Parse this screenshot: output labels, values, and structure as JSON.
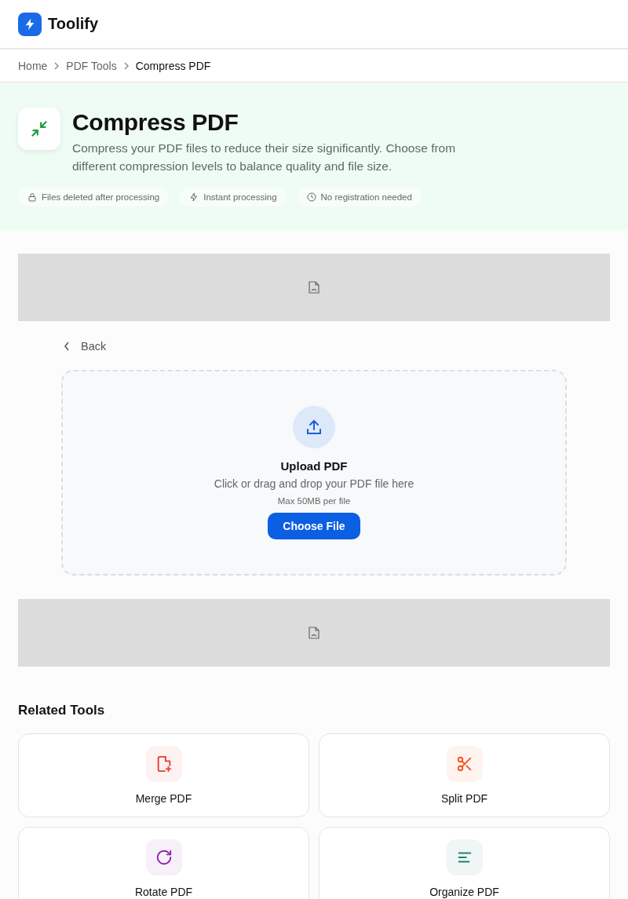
{
  "header": {
    "brand": "Toolify"
  },
  "breadcrumb": [
    {
      "label": "Home",
      "current": false
    },
    {
      "label": "PDF Tools",
      "current": false
    },
    {
      "label": "Compress PDF",
      "current": true
    }
  ],
  "hero": {
    "title": "Compress PDF",
    "description": "Compress your PDF files to reduce their size significantly. Choose from different compression levels to balance quality and file size.",
    "badges": [
      {
        "kind": "lock",
        "label": "Files deleted after processing"
      },
      {
        "kind": "bolt",
        "label": "Instant processing"
      },
      {
        "kind": "clock",
        "label": "No registration needed"
      }
    ]
  },
  "back": "Back",
  "upload": {
    "title": "Upload PDF",
    "hint": "Click or drag and drop your PDF file here",
    "limit": "Max 50MB per file",
    "button": "Choose File"
  },
  "related": {
    "heading": "Related Tools",
    "tools": [
      {
        "kind": "merge",
        "label": "Merge PDF",
        "color": "#e53935"
      },
      {
        "kind": "split",
        "label": "Split PDF",
        "color": "#f4511e"
      },
      {
        "kind": "rotate",
        "label": "Rotate PDF",
        "color": "#8e24aa"
      },
      {
        "kind": "organize",
        "label": "Organize PDF",
        "color": "#26806f"
      }
    ]
  }
}
